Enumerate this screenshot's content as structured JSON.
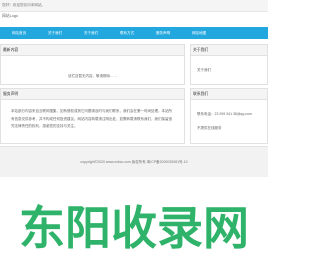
{
  "topbar": {
    "text": "您好！欢迎您访问本网站。"
  },
  "logo": {
    "text": "网站Logo"
  },
  "nav": {
    "items": [
      {
        "label": "网站首页"
      },
      {
        "label": "关于我们"
      },
      {
        "label": "关于我们"
      },
      {
        "label": "联系方式"
      },
      {
        "label": "服务声明"
      },
      {
        "label": "网站地图"
      }
    ]
  },
  "latest": {
    "title": "最新内容",
    "notice": "该栏目暂无内容，敬请期待……"
  },
  "about_side": {
    "title": "关于我们",
    "link": "关于我们"
  },
  "statement": {
    "title": "服务声明",
    "text": "本站部分内容来自互联网搜集，如有侵权或其它问题请及时与我们联系，我们会在第一时间处理。本站所有信息仅供参考，并不构成任何投资建议。网站内容转载请注明出处，如需转载请联系我们，我们保留追究法律责任的权利，感谢您的支持与关注。"
  },
  "contact": {
    "title": "联系我们",
    "phone": "联系电话：23 299 341 38@qq.com",
    "hours": "不提供在线服务"
  },
  "footer": {
    "copyright": "copyright©2020 www.xxbcc.com 版权所有   粤ICP备2020030081号-10"
  },
  "watermark": {
    "text": "东阳收录网",
    "color": "#2fb36a"
  }
}
